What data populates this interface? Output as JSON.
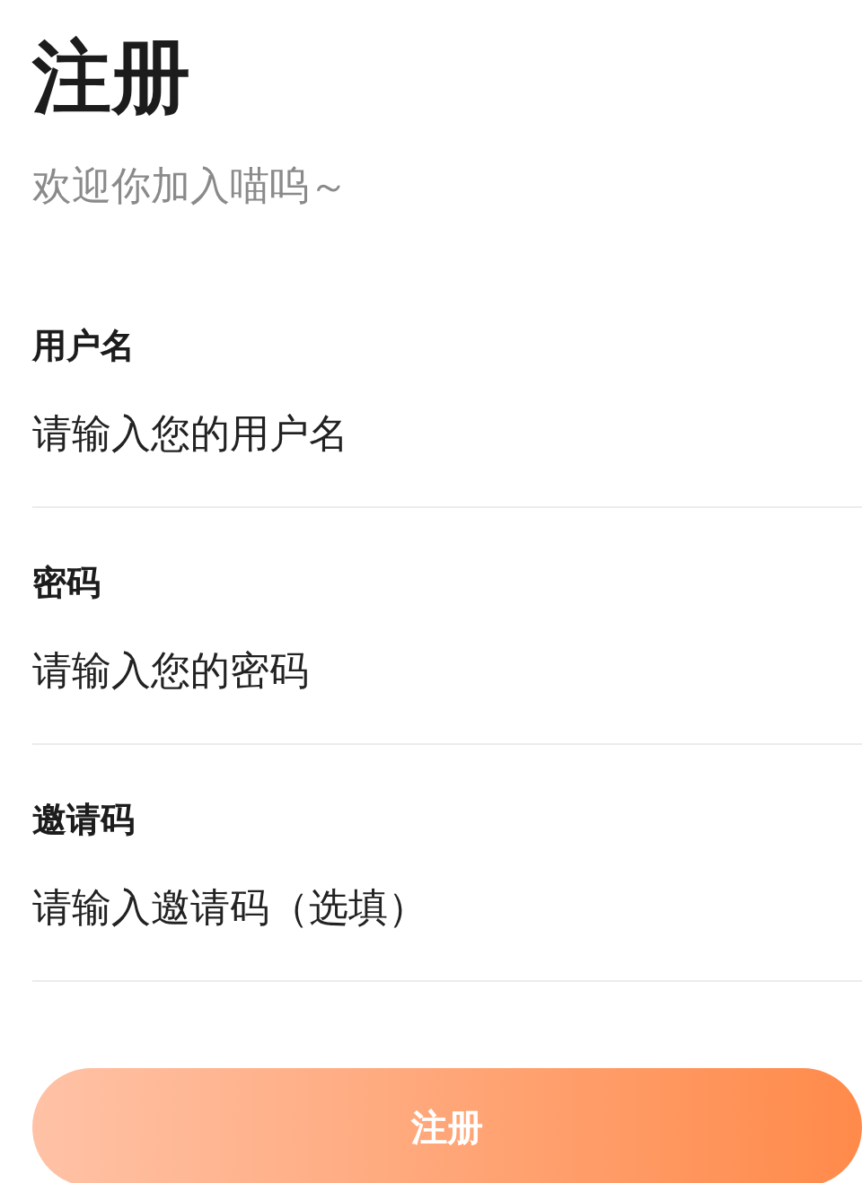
{
  "title": "注册",
  "subtitle": "欢迎你加入喵呜～",
  "fields": [
    {
      "label": "用户名",
      "placeholder": "请输入您的用户名"
    },
    {
      "label": "密码",
      "placeholder": "请输入您的密码"
    },
    {
      "label": "邀请码",
      "placeholder": "请输入邀请码（选填）"
    }
  ],
  "submit": {
    "label": "注册"
  }
}
